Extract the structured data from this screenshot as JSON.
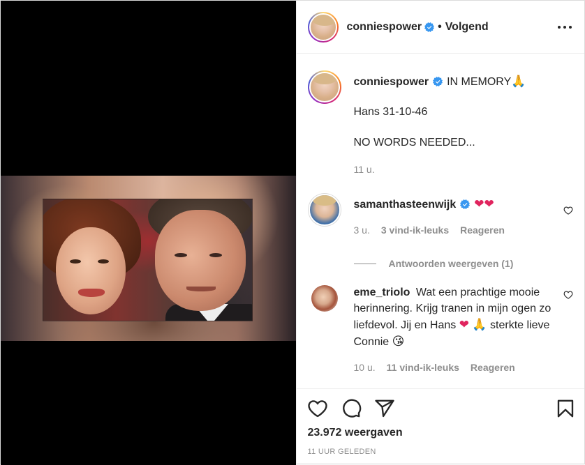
{
  "header": {
    "username": "conniespower",
    "separator": "•",
    "follow_label": "Volgend"
  },
  "caption": {
    "username": "conniespower",
    "line1_text": "IN MEMORY",
    "line1_emoji": "🙏",
    "line2": "Hans 31-10-46",
    "line3": "NO WORDS NEEDED...",
    "time": "11 u."
  },
  "comments": [
    {
      "username": "samanthasteenwijk",
      "text": "",
      "emojis": "❤❤",
      "time": "3 u.",
      "likes": "3 vind-ik-leuks",
      "reply_label": "Reageren",
      "view_replies": "Antwoorden weergeven (1)"
    },
    {
      "username": "eme_triolo",
      "text_part1": "Wat een prachtige mooie herinnering. Krijg tranen in mijn ogen zo liefdevol. Jij en Hans",
      "emoji_heart": "❤",
      "emoji_pray": "🙏",
      "text_part2": "sterkte lieve Connie",
      "emoji_kiss": "😘",
      "time": "10 u.",
      "likes": "11 vind-ik-leuks",
      "reply_label": "Reageren"
    }
  ],
  "footer": {
    "views": "23.972 weergaven",
    "time_ago": "11 UUR GELEDEN"
  },
  "colors": {
    "verified": "#3897f0",
    "heart": "#ed4956",
    "text": "#262626",
    "muted": "#8e8e8e"
  },
  "icons": [
    "heart-icon",
    "comment-icon",
    "share-icon",
    "bookmark-icon",
    "more-icon",
    "verified-badge-icon"
  ]
}
